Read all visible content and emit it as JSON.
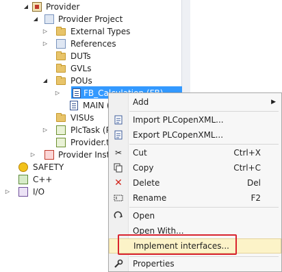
{
  "tree": {
    "items": [
      {
        "label": "Provider"
      },
      {
        "label": "Provider Project"
      },
      {
        "label": "External Types"
      },
      {
        "label": "References"
      },
      {
        "label": "DUTs"
      },
      {
        "label": "GVLs"
      },
      {
        "label": "POUs"
      },
      {
        "label": "FB_Calculation (FB)"
      },
      {
        "label": "MAIN (PRG)"
      },
      {
        "label": "VISUs"
      },
      {
        "label": "PlcTask (PlcTask)"
      },
      {
        "label": "Provider.tmc"
      },
      {
        "label": "Provider Instance"
      },
      {
        "label": "SAFETY"
      },
      {
        "label": "C++"
      },
      {
        "label": "I/O"
      }
    ]
  },
  "context_menu": {
    "add": "Add",
    "import": "Import PLCopenXML...",
    "export": "Export PLCopenXML...",
    "cut": "Cut",
    "cut_shortcut": "Ctrl+X",
    "copy": "Copy",
    "copy_shortcut": "Ctrl+C",
    "delete": "Delete",
    "delete_shortcut": "Del",
    "rename": "Rename",
    "rename_shortcut": "F2",
    "open": "Open",
    "open_with": "Open With...",
    "implement": "Implement interfaces...",
    "properties": "Properties"
  },
  "colors": {
    "selection": "#3399ff",
    "highlight_box": "#d9232e",
    "hover": "#fcf3c8"
  }
}
